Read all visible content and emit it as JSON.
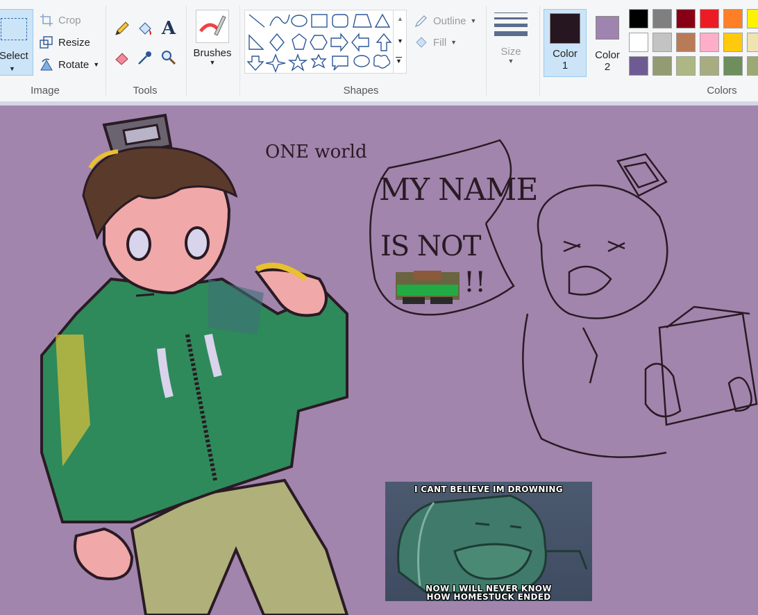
{
  "ribbon": {
    "image_group": {
      "label": "Image",
      "select_label": "Select",
      "crop_label": "Crop",
      "resize_label": "Resize",
      "rotate_label": "Rotate"
    },
    "tools_group": {
      "label": "Tools"
    },
    "brushes": {
      "label": "Brushes"
    },
    "shapes_group": {
      "label": "Shapes",
      "outline_label": "Outline",
      "fill_label": "Fill"
    },
    "size": {
      "label": "Size"
    },
    "colors_group": {
      "label": "Colors",
      "color1_label": "Color",
      "color1_num": "1",
      "color2_label": "Color",
      "color2_num": "2",
      "color1_value": "#26161f",
      "color2_value": "#9e84ae",
      "palette": [
        "#000000",
        "#7f7f7f",
        "#880015",
        "#ed1c24",
        "#ff7f27",
        "#fff200",
        "#ffffff",
        "#c3c3c3",
        "#b97a57",
        "#ffaec9",
        "#ffc90e",
        "#efe4b0",
        "#6f5b93",
        "#939b72",
        "#adb783",
        "#a7ad80",
        "#6f8e5e",
        "#9ca974"
      ]
    }
  },
  "canvas": {
    "background": "#a185ad",
    "texts": {
      "one_world": "ONE world",
      "speech_line1": "MY NAME",
      "speech_line2": "IS NOT",
      "speech_exclaim": "!!"
    },
    "meme": {
      "top_text": "I CANT BELIEVE IM DROWNING",
      "bottom_line1": "NOW I WILL NEVER KNOW",
      "bottom_line2": "HOW HOMESTUCK ENDED"
    }
  }
}
